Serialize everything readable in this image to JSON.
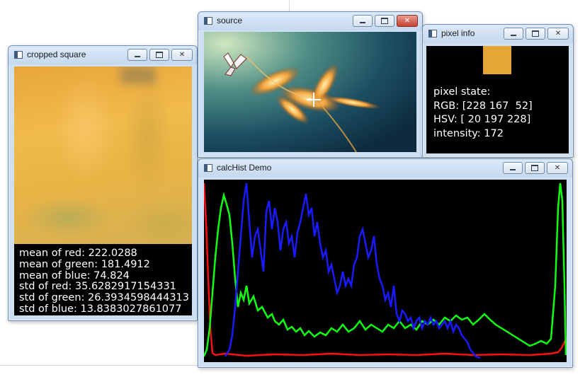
{
  "windows": {
    "cropped": {
      "title": "cropped square"
    },
    "source": {
      "title": "source"
    },
    "pixel_info": {
      "title": "pixel info"
    },
    "hist": {
      "title": "calcHist Demo"
    }
  },
  "stats": {
    "mean_red": "mean of red: 222.0288",
    "mean_green": "mean of green: 181.4912",
    "mean_blue": "mean of blue: 74.824",
    "std_red": "std of red: 35.6282917154331",
    "std_green": "std of green: 26.3934598444313",
    "std_blue": "std of blue: 13.8383027861077"
  },
  "pixel": {
    "state_label": "pixel state:",
    "rgb": "RGB: [228 167  52]",
    "hsv": "HSV: [ 20 197 228]",
    "intensity": "intensity: 172",
    "swatch_color": "#e4a734"
  },
  "colors": {
    "hist_red": "#ff1010",
    "hist_green": "#10ff10",
    "hist_blue": "#1a1aff"
  },
  "icons": {
    "minimize": "minimize-icon",
    "maximize": "maximize-icon",
    "close": "close-icon"
  }
}
